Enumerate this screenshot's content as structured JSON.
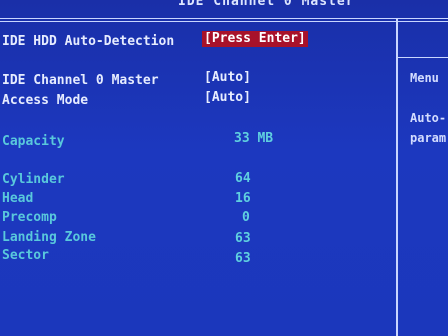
{
  "header": {
    "title": "IDE Channel 0 Master"
  },
  "settings": {
    "auto_detection": {
      "label": "IDE HDD Auto-Detection",
      "value": "[Press Enter]"
    },
    "channel_master": {
      "label": "IDE Channel 0 Master",
      "value": "[Auto]"
    },
    "access_mode": {
      "label": "Access Mode",
      "value": "[Auto]"
    }
  },
  "drive_info": {
    "capacity": {
      "label": "Capacity",
      "value": "33 MB"
    },
    "cylinder": {
      "label": "Cylinder",
      "value": "64"
    },
    "head": {
      "label": "Head",
      "value": "16"
    },
    "precomp": {
      "label": "Precomp",
      "value": "0"
    },
    "landing_zone": {
      "label": "Landing Zone",
      "value": "63"
    },
    "sector": {
      "label": "Sector",
      "value": "63"
    }
  },
  "help_panel": {
    "heading": "Menu",
    "line1": "Auto-",
    "line2": "param"
  },
  "colors": {
    "background": "#1b34b6",
    "highlight": "#a8122a",
    "label_text": "#e6ecff",
    "info_text": "#59c8dc"
  }
}
